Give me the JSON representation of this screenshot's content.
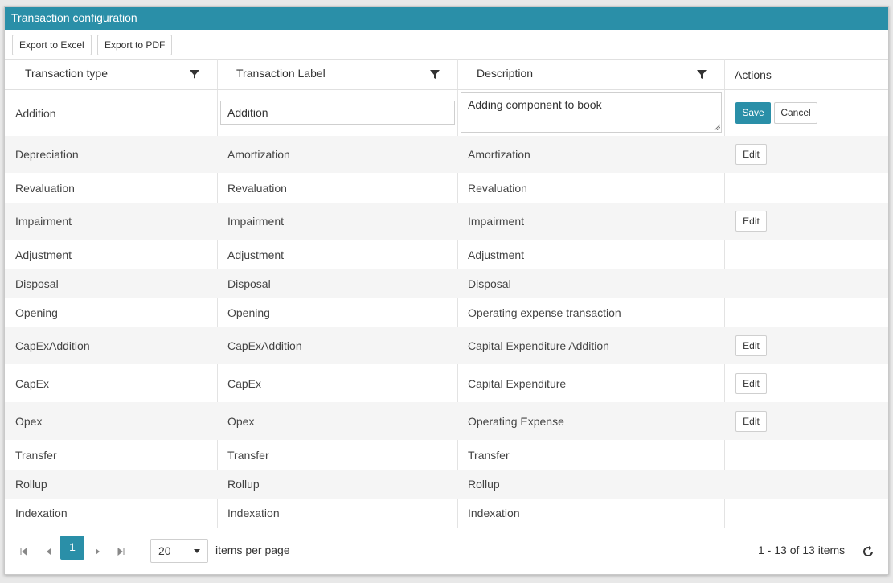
{
  "title": "Transaction configuration",
  "toolbar": {
    "export_excel": "Export to Excel",
    "export_pdf": "Export to PDF"
  },
  "columns": [
    "Transaction type",
    "Transaction Label",
    "Description",
    "Actions"
  ],
  "edit_row": {
    "type": "Addition",
    "label_value": "Addition",
    "description_value": "Adding component to book",
    "save": "Save",
    "cancel": "Cancel"
  },
  "rows": [
    {
      "type": "Depreciation",
      "label": "Amortization",
      "description": "Amortization",
      "action": "Edit"
    },
    {
      "type": "Revaluation",
      "label": "Revaluation",
      "description": "Revaluation",
      "action": ""
    },
    {
      "type": "Impairment",
      "label": "Impairment",
      "description": "Impairment",
      "action": "Edit"
    },
    {
      "type": "Adjustment",
      "label": "Adjustment",
      "description": "Adjustment",
      "action": ""
    },
    {
      "type": "Disposal",
      "label": "Disposal",
      "description": "Disposal",
      "action": ""
    },
    {
      "type": "Opening",
      "label": "Opening",
      "description": "Operating expense transaction",
      "action": ""
    },
    {
      "type": "CapExAddition",
      "label": "CapExAddition",
      "description": "Capital Expenditure Addition",
      "action": "Edit"
    },
    {
      "type": "CapEx",
      "label": "CapEx",
      "description": "Capital Expenditure",
      "action": "Edit"
    },
    {
      "type": "Opex",
      "label": "Opex",
      "description": "Operating Expense",
      "action": "Edit"
    },
    {
      "type": "Transfer",
      "label": "Transfer",
      "description": "Transfer",
      "action": ""
    },
    {
      "type": "Rollup",
      "label": "Rollup",
      "description": "Rollup",
      "action": ""
    },
    {
      "type": "Indexation",
      "label": "Indexation",
      "description": "Indexation",
      "action": ""
    }
  ],
  "pager": {
    "current_page": "1",
    "page_size": "20",
    "items_per_page": "items per page",
    "summary": "1 - 13 of 13 items"
  },
  "colors": {
    "accent": "#2a8fa8"
  },
  "icons": [
    "filter-icon",
    "first-page-icon",
    "prev-page-icon",
    "next-page-icon",
    "last-page-icon",
    "dropdown-arrow-icon",
    "refresh-icon"
  ]
}
